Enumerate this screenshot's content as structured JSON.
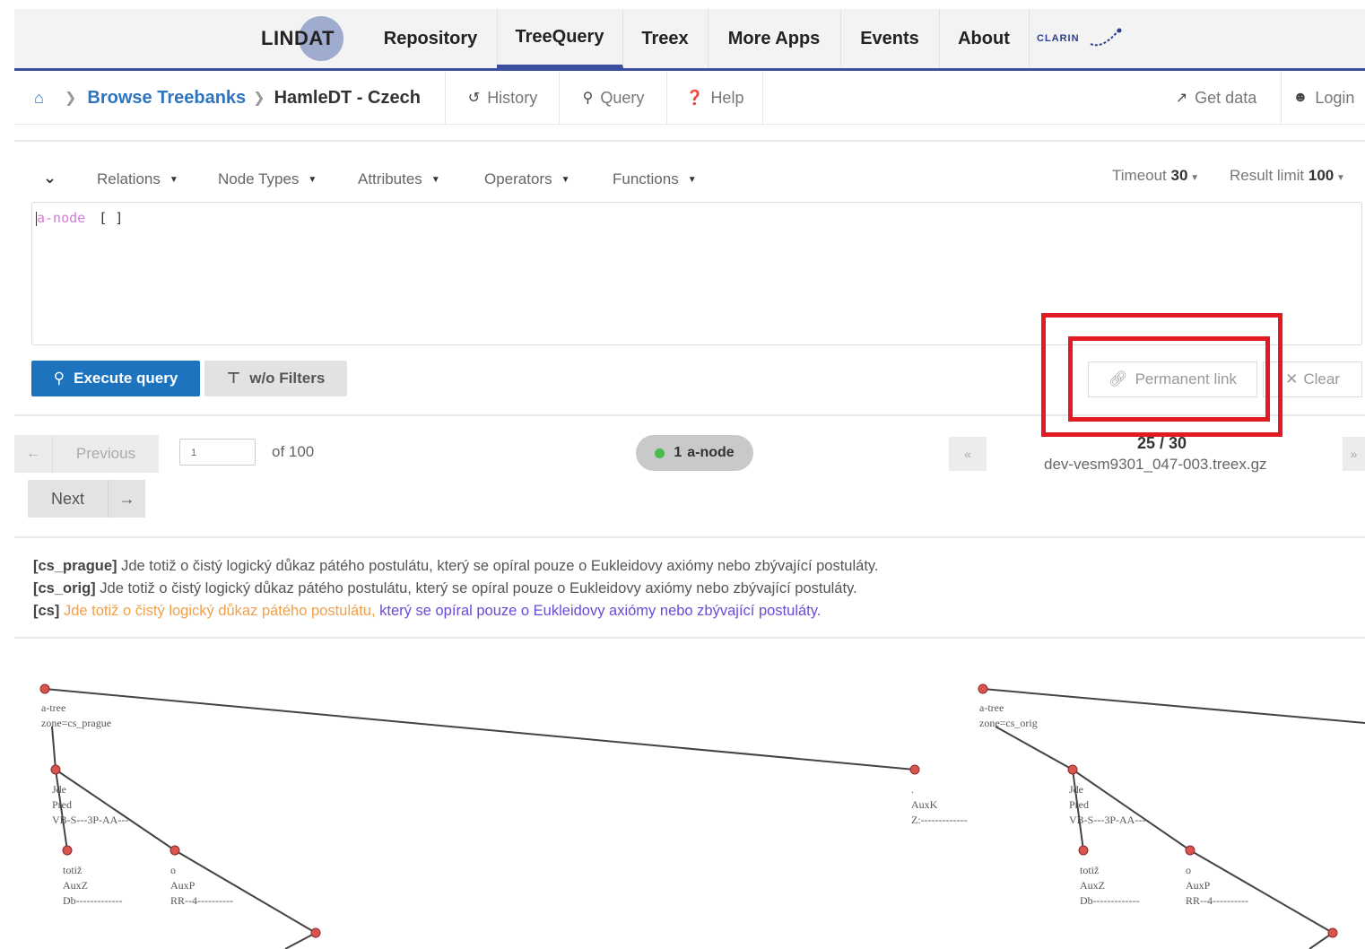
{
  "topnav": {
    "logo_text": "LINDAT",
    "items": [
      "Repository",
      "TreeQuery",
      "Treex",
      "More Apps",
      "Events",
      "About"
    ],
    "clarin_text": "CLARIN"
  },
  "breadcrumb": {
    "browse": "Browse Treebanks",
    "current": "HamleDT - Czech"
  },
  "toolbar": {
    "history": "History",
    "query": "Query",
    "help": "Help",
    "get_data": "Get data",
    "login": "Login"
  },
  "query_menu": {
    "relations": "Relations",
    "node_types": "Node Types",
    "attributes": "Attributes",
    "operators": "Operators",
    "functions": "Functions",
    "timeout_label": "Timeout",
    "timeout_value": "30",
    "limit_label": "Result limit",
    "limit_value": "100"
  },
  "editor": {
    "keyword": "a-node",
    "brackets": "[ ]"
  },
  "buttons": {
    "execute": "Execute query",
    "filters": "w/o Filters",
    "permanent_link": "Permanent link",
    "clear": "Clear"
  },
  "pager": {
    "previous": "Previous",
    "page_value": "1",
    "of_total": "of 100",
    "next": "Next",
    "node_count": "1",
    "node_label": "a-node",
    "tree_position": "25 / 30",
    "file": "dev-vesm9301_047-003.treex.gz"
  },
  "sentences": [
    {
      "tag": "[cs_prague]",
      "text": "Jde totiž o čistý logický důkaz pátého postulátu, který se opíral pouze o Eukleidovy axiómy nebo zbývající postuláty."
    },
    {
      "tag": "[cs_orig]",
      "text": "Jde totiž o čistý logický důkaz pátého postulátu, který se opíral pouze o Eukleidovy axiómy nebo zbývající postuláty."
    },
    {
      "tag": "[cs]",
      "part1": "Jde totiž o čistý logický důkaz pátého postulátu,",
      "part2": "který se opíral pouze o Eukleidovy axiómy nebo zbývající postuláty."
    }
  ],
  "tree_left": {
    "root": [
      "a-tree",
      "zone=cs_prague"
    ],
    "jde": [
      "Jde",
      "Pred",
      "VB-S---3P-AA---"
    ],
    "totiz": [
      "totiž",
      "AuxZ",
      "Db-------------"
    ],
    "o": [
      "o",
      "AuxP",
      "RR--4----------"
    ],
    "auxk": [
      ".",
      "AuxK",
      "Z:-------------"
    ]
  },
  "tree_right": {
    "root": [
      "a-tree",
      "zone=cs_orig"
    ],
    "jde": [
      "Jde",
      "Pred",
      "VB-S---3P-AA---"
    ],
    "totiz": [
      "totiž",
      "AuxZ",
      "Db-------------"
    ],
    "o": [
      "o",
      "AuxP",
      "RR--4----------"
    ]
  },
  "colors": {
    "accent": "#1e73be",
    "nav_underline": "#3b4ea0",
    "highlight_box": "#e01b24",
    "node": "#d9534f"
  }
}
